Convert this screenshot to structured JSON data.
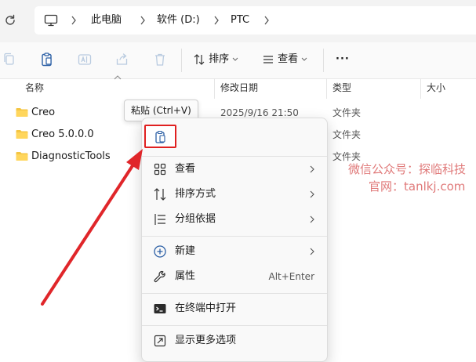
{
  "address": {
    "crumbs": [
      "此电脑",
      "软件 (D:)",
      "PTC"
    ]
  },
  "toolbar": {
    "sort_label": "排序",
    "view_label": "查看",
    "more_label": "···"
  },
  "file_list": {
    "columns": [
      "名称",
      "修改日期",
      "类型",
      "大小"
    ],
    "rows": [
      {
        "name": "Creo",
        "date": "2025/9/16 21:50",
        "type": "文件夹"
      },
      {
        "name": "Creo 5.0.0.0",
        "date": "",
        "type": "文件夹"
      },
      {
        "name": "DiagnosticTools",
        "date": "",
        "type": "文件夹"
      }
    ]
  },
  "tooltip": {
    "text": "粘贴 (Ctrl+V)"
  },
  "context_menu": {
    "items": [
      {
        "label": "查看",
        "icon": "grid-icon"
      },
      {
        "label": "排序方式",
        "icon": "sort-icon"
      },
      {
        "label": "分组依据",
        "icon": "group-icon"
      },
      {
        "label": "新建",
        "icon": "plus-circle-icon"
      },
      {
        "label": "属性",
        "icon": "wrench-icon",
        "shortcut": "Alt+Enter"
      },
      {
        "label": "在终端中打开",
        "icon": "terminal-icon"
      },
      {
        "label": "显示更多选项",
        "icon": "more-options-icon"
      }
    ]
  },
  "watermark": {
    "line1": "微信公众号：探临科技",
    "line2": "官网：tanlkj.com"
  },
  "colors": {
    "folder": "#f4c542",
    "highlight": "#e02020",
    "arrow": "#e0262a",
    "watermark": "#e07a7a"
  }
}
